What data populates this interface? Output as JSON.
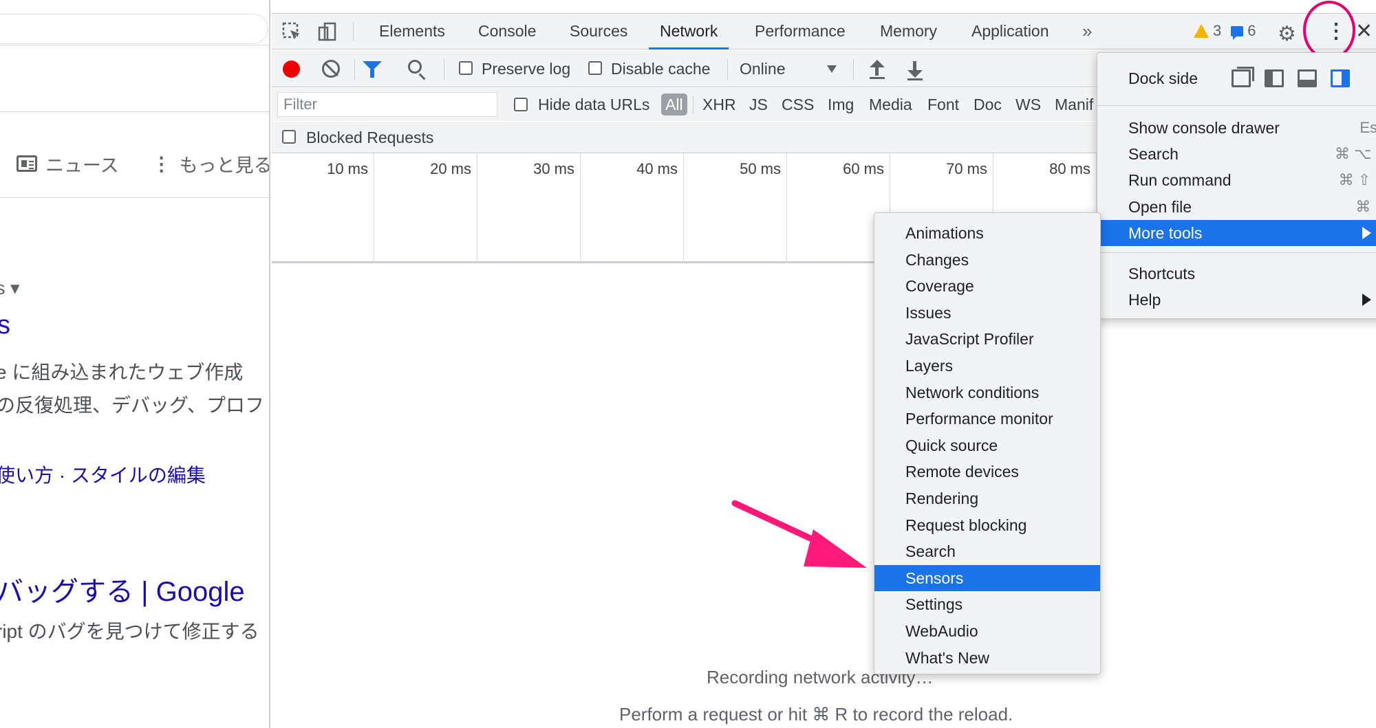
{
  "left_page": {
    "tab_news": "ニュース",
    "tab_more": "もっと見る",
    "crumb": "s ▾",
    "result1_title": "s",
    "result1_snippet_line1": "e に組み込まれたウェブ作成",
    "result1_snippet_line2": "の反復処理、デバッグ、プロフ",
    "result1_links": "使い方 · スタイルの編集",
    "result2_title": "バッグする | Google",
    "result2_snippet": "ript のバグを見つけて修正する"
  },
  "devtools": {
    "tabs": [
      "Elements",
      "Console",
      "Sources",
      "Network",
      "Performance",
      "Memory",
      "Application"
    ],
    "active_tab": "Network",
    "more_tabs": "»",
    "warnings_count": "3",
    "messages_count": "6",
    "close": "✕",
    "toolbar": {
      "preserve_log": "Preserve log",
      "disable_cache": "Disable cache",
      "throttling": "Online"
    },
    "filter": {
      "placeholder": "Filter",
      "hide_data_urls": "Hide data URLs",
      "types": [
        "All",
        "XHR",
        "JS",
        "CSS",
        "Img",
        "Media",
        "Font",
        "Doc",
        "WS",
        "Manif"
      ]
    },
    "blocked_requests": "Blocked Requests",
    "timeline_ticks": [
      "10 ms",
      "20 ms",
      "30 ms",
      "40 ms",
      "50 ms",
      "60 ms",
      "70 ms",
      "80 ms"
    ],
    "empty_line1": "Recording network activity…",
    "empty_line2": "Perform a request or hit ⌘ R to record the reload."
  },
  "main_menu": {
    "dock_side": "Dock side",
    "items": [
      {
        "label": "Show console drawer",
        "shortcut": "Esc"
      },
      {
        "label": "Search",
        "shortcut": "⌘ ⌥ F"
      },
      {
        "label": "Run command",
        "shortcut": "⌘ ⇧ P"
      },
      {
        "label": "Open file",
        "shortcut": "⌘ P"
      },
      {
        "label": "More tools",
        "shortcut": ""
      }
    ],
    "shortcuts": "Shortcuts",
    "help": "Help"
  },
  "more_tools_menu": {
    "items": [
      "Animations",
      "Changes",
      "Coverage",
      "Issues",
      "JavaScript Profiler",
      "Layers",
      "Network conditions",
      "Performance monitor",
      "Quick source",
      "Remote devices",
      "Rendering",
      "Request blocking",
      "Search",
      "Sensors",
      "Settings",
      "WebAudio",
      "What's New"
    ],
    "selected": "Sensors"
  },
  "colors": {
    "accent": "#1a73e8",
    "record": "#ee0000",
    "annotation": "#e6006f"
  }
}
